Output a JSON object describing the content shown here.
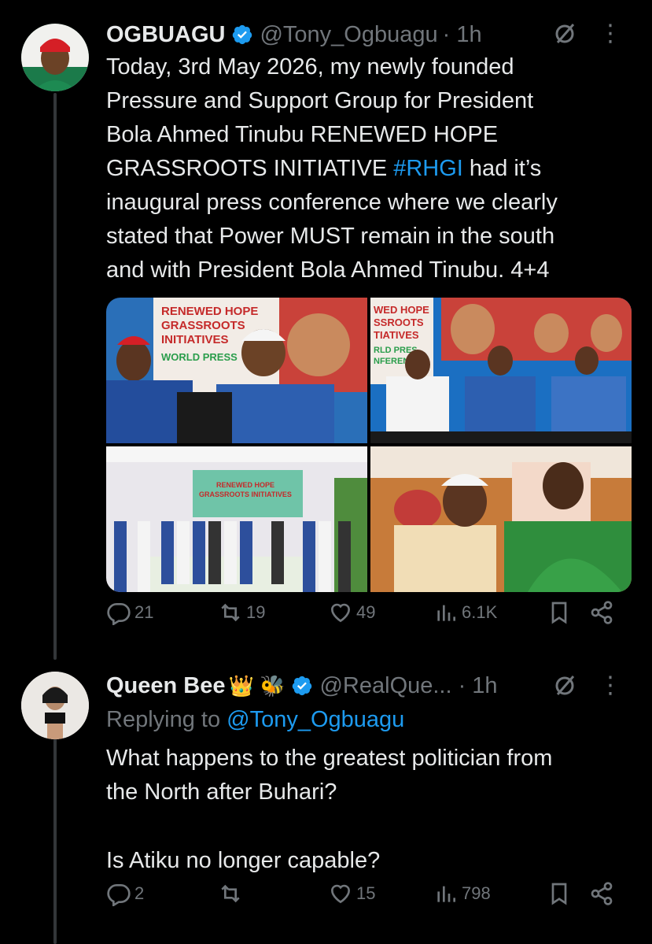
{
  "colors": {
    "background": "#000000",
    "text": "#e7e9ea",
    "muted": "#71767b",
    "link": "#1d9bf0",
    "verified": "#1d9bf0"
  },
  "post": {
    "author_name": "OGBUAGU",
    "handle": "@Tony_Ogbuagu",
    "time": "· 1h",
    "text_before_hashtag": "Today, 3rd May 2026, my newly founded\nPressure and Support Group for President\nBola Ahmed Tinubu RENEWED HOPE\nGRASSROOTS INITIATIVE ",
    "hashtag": "#RHGI",
    "text_after_hashtag": " had it’s\ninaugural press conference where we clearly\nstated that Power MUST remain in the south\nand with President Bola Ahmed Tinubu. 4+4",
    "media_banner_text": {
      "img1": [
        "RENEWED HOPE",
        "GRASSROOTS",
        "INITIATIVES",
        "WORLD PRESS"
      ],
      "img2": [
        "WED HOPE",
        "SSROOTS",
        "TIATIVES",
        "RLD PRES",
        "NFEREN"
      ],
      "img3": [
        "RENEWED HOPE",
        "GRASSROOTS INITIATIVES"
      ]
    },
    "stats": {
      "replies": "21",
      "reposts": "19",
      "likes": "49",
      "views": "6.1K"
    }
  },
  "reply": {
    "author_name": "Queen Bee",
    "emojis": "👑 🐝",
    "handle": "@RealQue...",
    "time": "· 1h",
    "replying_label": "Replying to ",
    "replying_handle": "@Tony_Ogbuagu",
    "text_line1": "What happens to the greatest politician from\nthe North after Buhari?",
    "text_line2": "Is Atiku no longer capable?",
    "stats": {
      "replies": "2",
      "reposts": "",
      "likes": "15",
      "views": "798"
    }
  },
  "icons": [
    "verified-badge-icon",
    "grok-icon",
    "more-icon",
    "reply-icon",
    "repost-icon",
    "like-icon",
    "views-icon",
    "bookmark-icon",
    "share-icon"
  ]
}
